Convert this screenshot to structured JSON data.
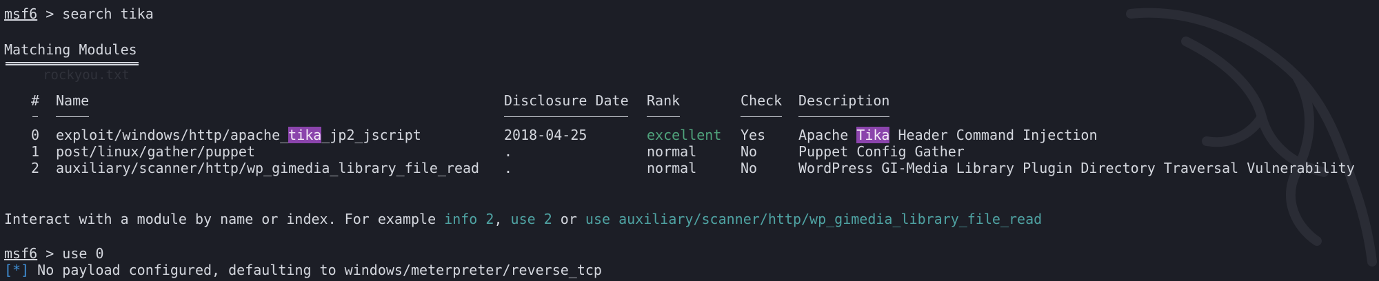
{
  "prompt": "msf6",
  "command1": "search tika",
  "section_title": "Matching Modules",
  "bg_ghost_text": "rockyou.txt",
  "table": {
    "headers": [
      "#",
      "Name",
      "Disclosure Date",
      "Rank",
      "Check",
      "Description"
    ],
    "rows": [
      {
        "index": "0",
        "name_pre": "exploit/windows/http/apache_",
        "name_hl": "tika",
        "name_post": "_jp2_jscript",
        "date": "2018-04-25",
        "rank": "excellent",
        "check": "Yes",
        "desc_pre": "Apache ",
        "desc_hl": "Tika",
        "desc_post": " Header Command Injection"
      },
      {
        "index": "1",
        "name": "post/linux/gather/puppet",
        "date": ".",
        "rank": "normal",
        "check": "No",
        "desc": "Puppet Config Gather"
      },
      {
        "index": "2",
        "name": "auxiliary/scanner/http/wp_gimedia_library_file_read",
        "date": ".",
        "rank": "normal",
        "check": "No",
        "desc": "WordPress GI-Media Library Plugin Directory Traversal Vulnerability"
      }
    ]
  },
  "interact": {
    "pre": "Interact with a module by name or index. For example ",
    "cmd1": "info 2",
    "sep1": ", ",
    "cmd2": "use 2",
    "sep2": " or ",
    "cmd3": "use auxiliary/scanner/http/wp_gimedia_library_file_read"
  },
  "command2": "use 0",
  "status_marker": "[*]",
  "status_text": " No payload configured, defaulting to windows/meterpreter/reverse_tcp",
  "colors": {
    "background": "#1c1e26",
    "foreground": "#d4d7de",
    "highlight": "#8b44ac",
    "rank_excellent": "#4fa37c",
    "link_teal": "#4fa3a3",
    "status_blue": "#3f8fd6"
  }
}
